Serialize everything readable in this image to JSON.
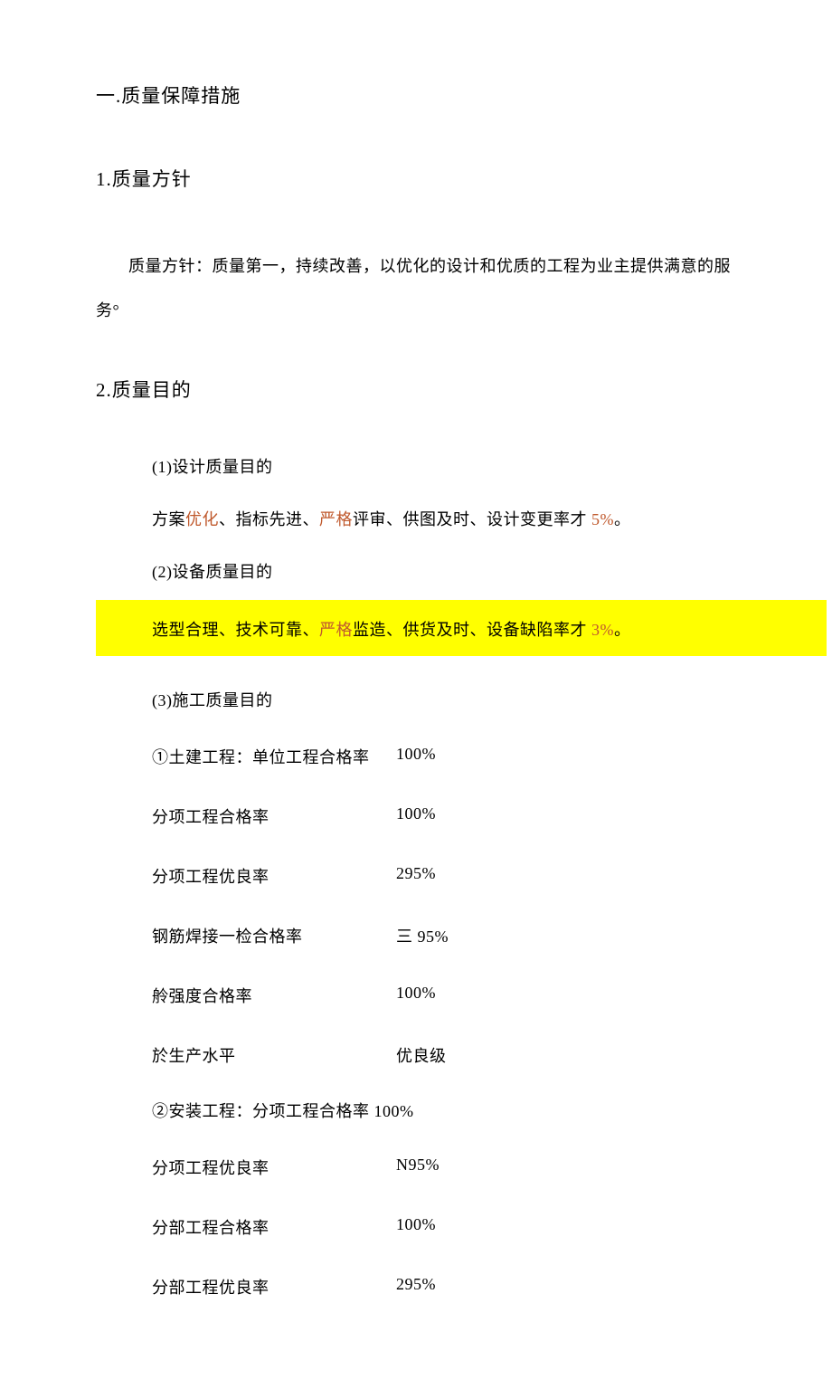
{
  "heading_main": "一.质量保障措施",
  "section1": {
    "heading": "1.质量方针",
    "body": "质量方针：质量第一，持续改善，以优化的设计和优质的工程为业主提供满意的服务°"
  },
  "section2": {
    "heading": "2.质量目的",
    "item1_label": "(1)设计质量目的",
    "item1_body_parts": {
      "p0": "方案",
      "a0": "优化",
      "p1": "、指标先进、",
      "a1": "严格",
      "p2": "评审、供图及时、设计变更率才 ",
      "a2": "5%",
      "p3": "。"
    },
    "item2_label": "(2)设备质量目的",
    "item2_body_parts": {
      "p0": "选型合理、技术可靠、",
      "a0": "严格",
      "p1": "监造、供货及时、设备缺陷率才 ",
      "a1": "3%",
      "p2": "。"
    },
    "item3_label": "(3)施工质量目的",
    "construction": {
      "first_line": "①土建工程：单位工程合格率",
      "first_value": "100%",
      "rows": [
        {
          "label": "分项工程合格率",
          "value": "100%"
        },
        {
          "label": "分项工程优良率",
          "value": "295%"
        },
        {
          "label": "钢筋焊接一检合格率",
          "value": "三 95%"
        },
        {
          "label": "舲强度合格率",
          "value": "100%"
        },
        {
          "label": "於生产水平",
          "value": "优良级"
        }
      ],
      "install_line": "②安装工程：分项工程合格率 100%",
      "install_rows": [
        {
          "label": "分项工程优良率",
          "value": "N95%"
        },
        {
          "label": "分部工程合格率",
          "value": "100%"
        },
        {
          "label": "分部工程优良率",
          "value": "295%"
        }
      ]
    }
  }
}
